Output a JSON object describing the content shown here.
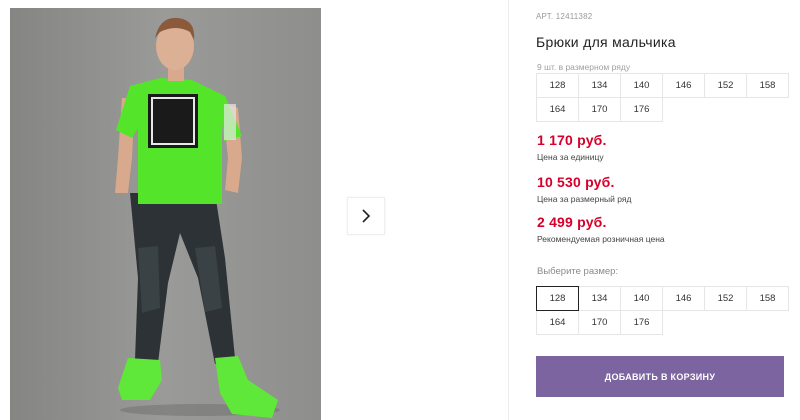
{
  "product": {
    "sku_label": "АРТ.",
    "sku_value": "12411382",
    "title": "Брюки для мальчика",
    "row_note": "9 шт. в размерном ряду",
    "row_sizes": [
      "128",
      "134",
      "140",
      "146",
      "152",
      "158",
      "164",
      "170",
      "176"
    ]
  },
  "prices": [
    {
      "value": "1 170 руб.",
      "label": "Цена за единицу"
    },
    {
      "value": "10 530 руб.",
      "label": "Цена за размерный ряд"
    },
    {
      "value": "2 499 руб.",
      "label": "Рекомендуемая розничная цена"
    }
  ],
  "size_picker": {
    "label": "Выберите размер:",
    "selected": "128",
    "sizes": [
      "128",
      "134",
      "140",
      "146",
      "152",
      "158",
      "164",
      "170",
      "176"
    ]
  },
  "cart": {
    "button_label": "ДОБАВИТЬ В КОРЗИНУ"
  },
  "gallery": {
    "next_icon": "chevron-right-icon"
  },
  "colors": {
    "accent_button": "#7b64a0",
    "price": "#d6002a",
    "shirt": "#54e52a"
  }
}
